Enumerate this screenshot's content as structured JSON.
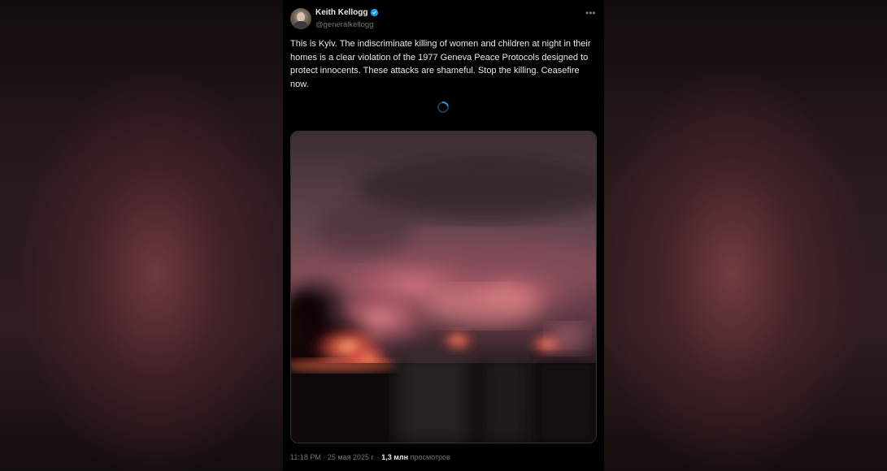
{
  "tweet": {
    "author": {
      "display_name": "Keith Kellogg",
      "handle": "@generalkellogg",
      "verified": true
    },
    "more_icon": "•••",
    "text": "This is Kyiv. The indiscriminate killing of women and children at night in their homes is a clear violation of the 1977 Geneva Peace Protocols designed to protect innocents. These attacks are shameful. Stop the killing. Ceasefire now.",
    "meta": {
      "time": "11:18 PM",
      "separator": "·",
      "date": "25 мая 2025 г.",
      "views_count": "1,3 млн",
      "views_label": "просмотров"
    }
  },
  "colors": {
    "background": "#000000",
    "text": "#e7e9ea",
    "secondary": "#71767b",
    "accent": "#1d9bf0"
  }
}
